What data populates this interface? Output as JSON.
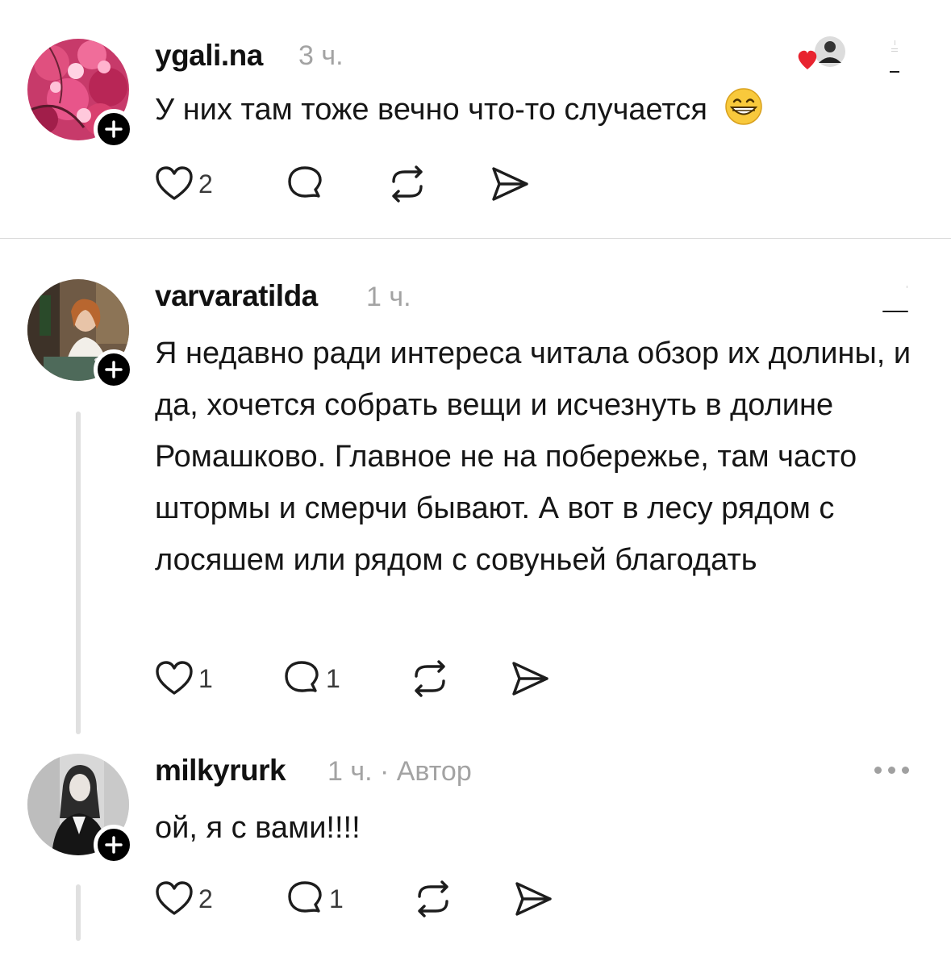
{
  "comments": [
    {
      "username": "ygali.na",
      "time": "3 ч.",
      "text": "У них там тоже вечно что-то случается",
      "emoji": "😁",
      "likes": "2",
      "replies": "",
      "avatar_icon": "pink-flowers-avatar"
    },
    {
      "username": "varvaratilda",
      "time": "1 ч.",
      "text": "Я недавно ради интереса читала обзор их долины, и да, хочется собрать вещи и исчезнуть в долине Ромашково. Главное не на побережье, там часто штормы и смерчи бывают. А вот в лесу рядом с лосяшем или рядом с совуньей благодать",
      "likes": "1",
      "replies": "1",
      "avatar_icon": "woman-in-cafe-avatar"
    },
    {
      "username": "milkyrurk",
      "time": "1 ч.",
      "separator": "·",
      "author_label": "Автор",
      "text": "ой, я с вами!!!!",
      "likes": "2",
      "replies": "1",
      "avatar_icon": "woman-bw-avatar"
    }
  ],
  "colors": {
    "heart_red": "#e8232f",
    "muted_text": "#a3a3a3",
    "divider": "#dcdcdc",
    "badge_bg": "#000000"
  }
}
